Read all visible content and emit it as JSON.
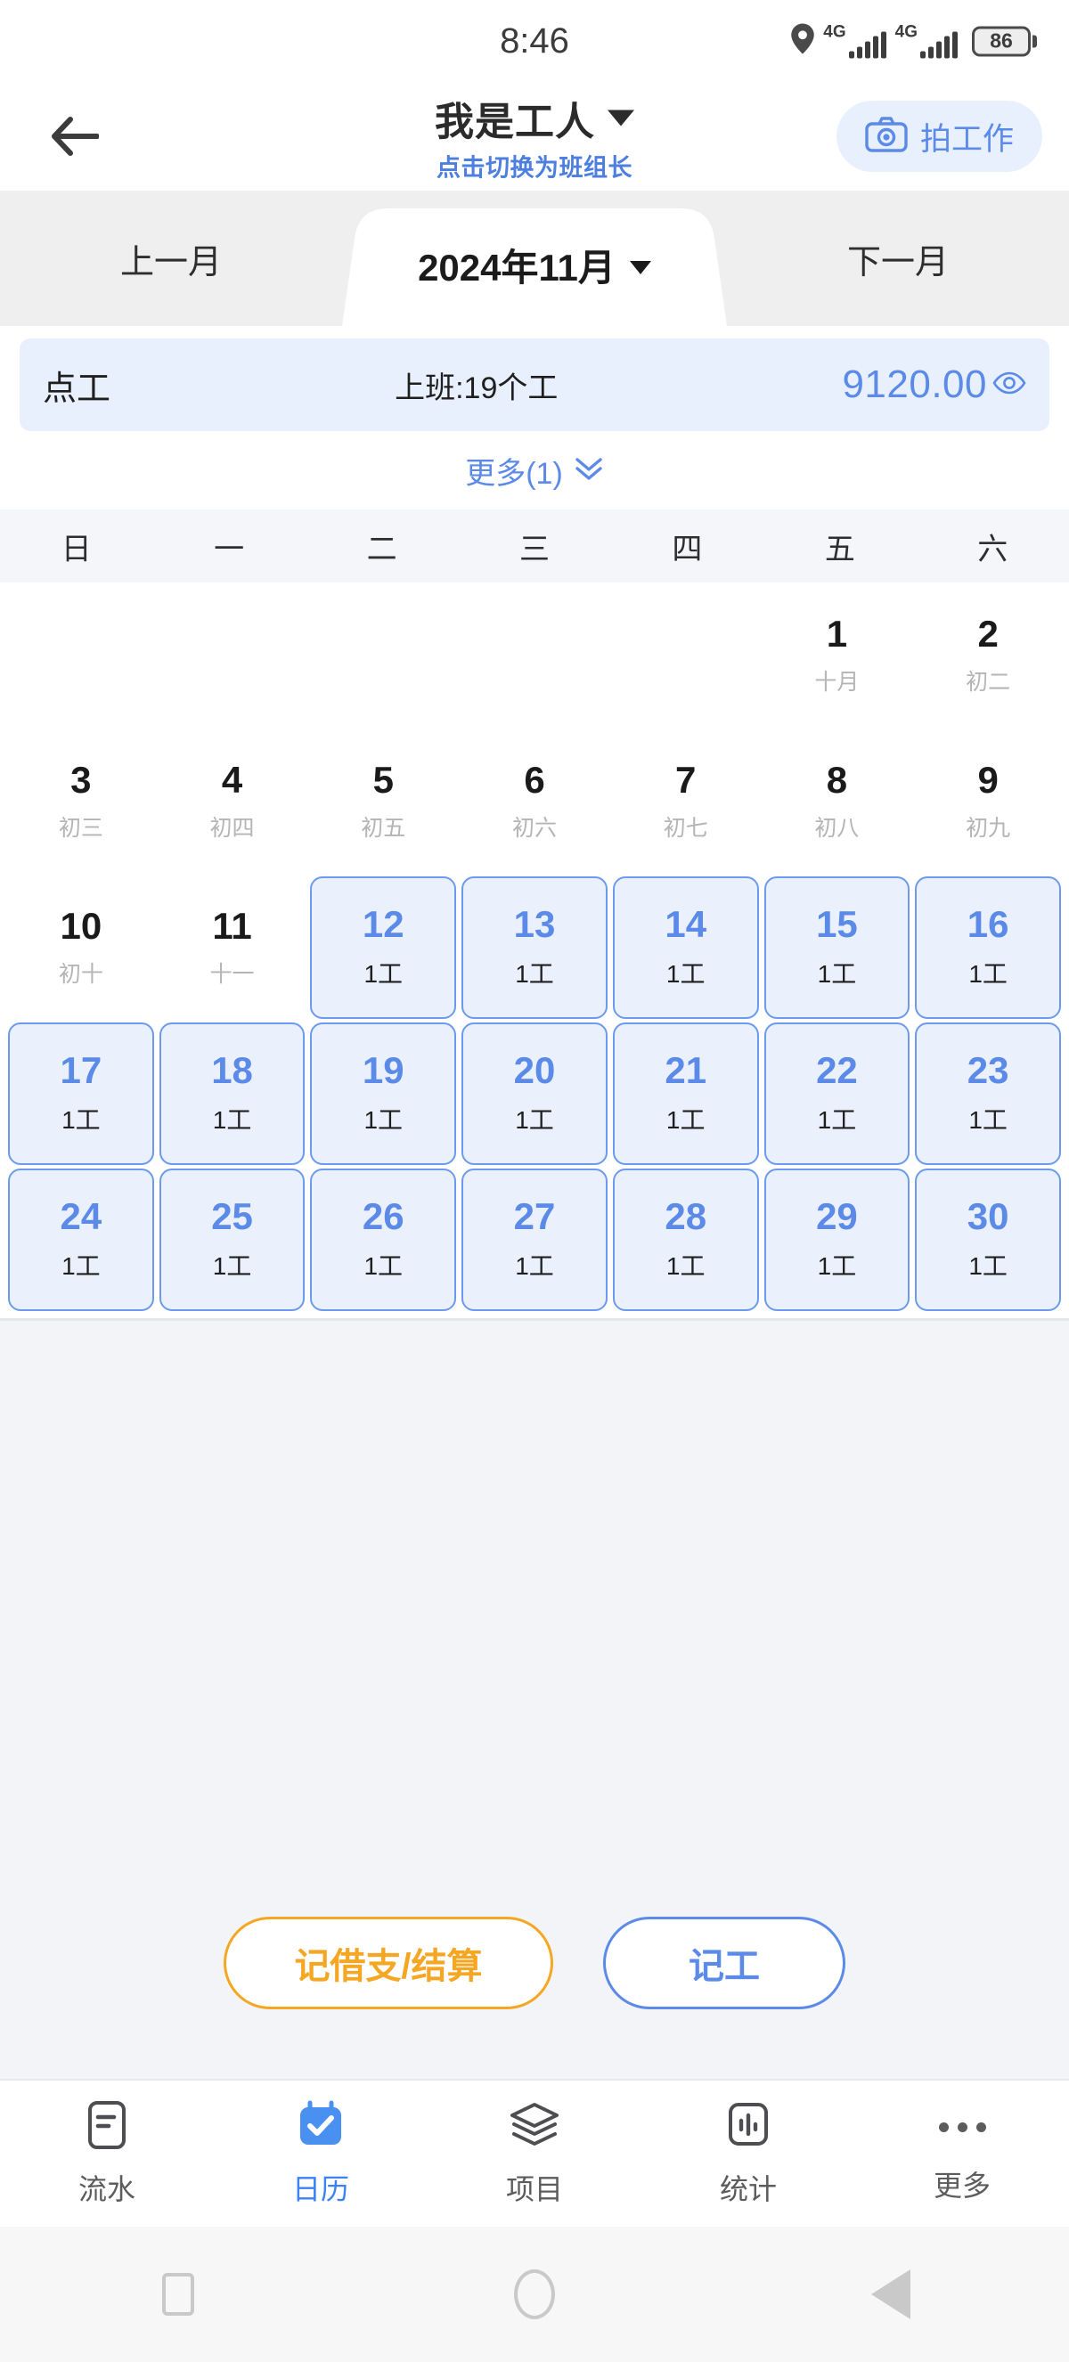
{
  "status_bar": {
    "time": "8:46",
    "network_label_1": "4G",
    "network_label_2": "4G",
    "battery_level": "86",
    "icons": [
      "location-pin-icon",
      "signal-bars-icon",
      "signal-bars-icon",
      "battery-icon"
    ]
  },
  "header": {
    "back_icon": "back-arrow-icon",
    "title": "我是工人",
    "title_caret": "caret-down-icon",
    "subtitle": "点击切换为班组长",
    "camera_button": {
      "icon": "camera-icon",
      "label": "拍工作"
    }
  },
  "month_tabs": {
    "prev": "上一月",
    "current": "2024年11月",
    "current_caret": "caret-down-icon",
    "next": "下一月"
  },
  "summary": {
    "work_type": "点工",
    "attendance": "上班:19个工",
    "amount": "9120.00",
    "eye_icon": "eye-icon",
    "more_label": "更多(1)",
    "more_icon": "double-chevron-down-icon"
  },
  "calendar": {
    "weekdays": [
      "日",
      "一",
      "二",
      "三",
      "四",
      "五",
      "六"
    ],
    "weeks": [
      [
        {
          "day": "",
          "sub": "",
          "marked": false,
          "empty": true
        },
        {
          "day": "",
          "sub": "",
          "marked": false,
          "empty": true
        },
        {
          "day": "",
          "sub": "",
          "marked": false,
          "empty": true
        },
        {
          "day": "",
          "sub": "",
          "marked": false,
          "empty": true
        },
        {
          "day": "",
          "sub": "",
          "marked": false,
          "empty": true
        },
        {
          "day": "1",
          "sub": "十月",
          "marked": false,
          "empty": false
        },
        {
          "day": "2",
          "sub": "初二",
          "marked": false,
          "empty": false
        }
      ],
      [
        {
          "day": "3",
          "sub": "初三",
          "marked": false,
          "empty": false
        },
        {
          "day": "4",
          "sub": "初四",
          "marked": false,
          "empty": false
        },
        {
          "day": "5",
          "sub": "初五",
          "marked": false,
          "empty": false
        },
        {
          "day": "6",
          "sub": "初六",
          "marked": false,
          "empty": false
        },
        {
          "day": "7",
          "sub": "初七",
          "marked": false,
          "empty": false
        },
        {
          "day": "8",
          "sub": "初八",
          "marked": false,
          "empty": false
        },
        {
          "day": "9",
          "sub": "初九",
          "marked": false,
          "empty": false
        }
      ],
      [
        {
          "day": "10",
          "sub": "初十",
          "marked": false,
          "empty": false
        },
        {
          "day": "11",
          "sub": "十一",
          "marked": false,
          "empty": false
        },
        {
          "day": "12",
          "sub": "1工",
          "marked": true,
          "empty": false
        },
        {
          "day": "13",
          "sub": "1工",
          "marked": true,
          "empty": false
        },
        {
          "day": "14",
          "sub": "1工",
          "marked": true,
          "empty": false
        },
        {
          "day": "15",
          "sub": "1工",
          "marked": true,
          "empty": false
        },
        {
          "day": "16",
          "sub": "1工",
          "marked": true,
          "empty": false
        }
      ],
      [
        {
          "day": "17",
          "sub": "1工",
          "marked": true,
          "empty": false
        },
        {
          "day": "18",
          "sub": "1工",
          "marked": true,
          "empty": false
        },
        {
          "day": "19",
          "sub": "1工",
          "marked": true,
          "empty": false
        },
        {
          "day": "20",
          "sub": "1工",
          "marked": true,
          "empty": false
        },
        {
          "day": "21",
          "sub": "1工",
          "marked": true,
          "empty": false
        },
        {
          "day": "22",
          "sub": "1工",
          "marked": true,
          "empty": false
        },
        {
          "day": "23",
          "sub": "1工",
          "marked": true,
          "empty": false
        }
      ],
      [
        {
          "day": "24",
          "sub": "1工",
          "marked": true,
          "empty": false
        },
        {
          "day": "25",
          "sub": "1工",
          "marked": true,
          "empty": false
        },
        {
          "day": "26",
          "sub": "1工",
          "marked": true,
          "empty": false
        },
        {
          "day": "27",
          "sub": "1工",
          "marked": true,
          "empty": false
        },
        {
          "day": "28",
          "sub": "1工",
          "marked": true,
          "empty": false
        },
        {
          "day": "29",
          "sub": "1工",
          "marked": true,
          "empty": false
        },
        {
          "day": "30",
          "sub": "1工",
          "marked": true,
          "empty": false
        }
      ]
    ]
  },
  "actions": {
    "loan_settle": "记借支/结算",
    "record_work": "记工"
  },
  "bottom_nav": {
    "items": [
      {
        "label": "流水",
        "icon": "ledger-icon",
        "active": false
      },
      {
        "label": "日历",
        "icon": "calendar-check-icon",
        "active": true
      },
      {
        "label": "项目",
        "icon": "layers-icon",
        "active": false
      },
      {
        "label": "统计",
        "icon": "bar-chart-icon",
        "active": false
      },
      {
        "label": "更多",
        "icon": "ellipsis-icon",
        "active": false
      }
    ]
  },
  "system_nav": {
    "recents_icon": "square-icon",
    "home_icon": "circle-icon",
    "back_icon": "triangle-back-icon"
  },
  "colors": {
    "accent_blue": "#5b8ae8",
    "accent_orange": "#f5a623",
    "cell_fill": "#eaf1fd",
    "cell_border": "#6b9aee",
    "page_bg": "#f3f4f8"
  }
}
